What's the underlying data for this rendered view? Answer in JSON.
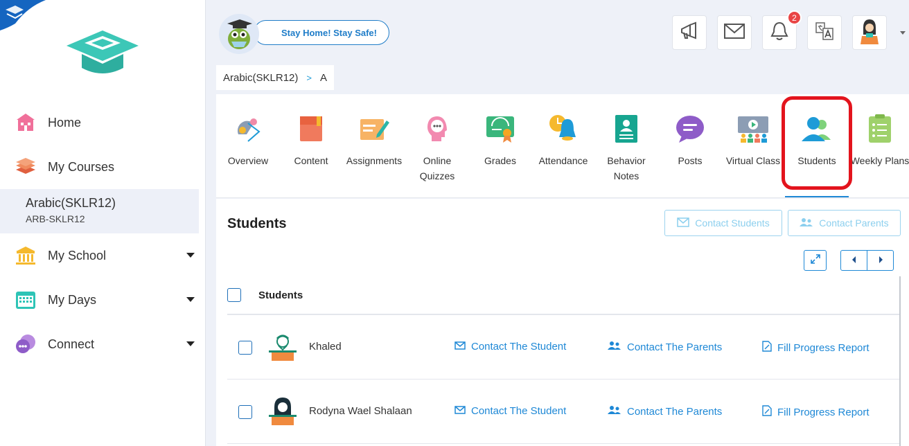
{
  "sidebar": {
    "items": [
      {
        "label": "Home",
        "icon": "home-icon"
      },
      {
        "label": "My Courses",
        "icon": "books-icon"
      },
      {
        "label": "My School",
        "icon": "school-icon"
      },
      {
        "label": "My Days",
        "icon": "calendar-icon"
      },
      {
        "label": "Connect",
        "icon": "chat-icon"
      }
    ],
    "course": {
      "title": "Arabic(SKLR12)",
      "code": "ARB-SKLR12"
    }
  },
  "header": {
    "banner": "Stay Home! Stay Safe!",
    "notifications_count": "2",
    "breadcrumb": {
      "course": "Arabic(SKLR12)",
      "separator": ">",
      "section": "A"
    }
  },
  "tabs": [
    {
      "label": "Overview"
    },
    {
      "label": "Content"
    },
    {
      "label": "Assignments"
    },
    {
      "label": "Online Quizzes"
    },
    {
      "label": "Grades"
    },
    {
      "label": "Attendance"
    },
    {
      "label": "Behavior Notes"
    },
    {
      "label": "Posts"
    },
    {
      "label": "Virtual Class"
    },
    {
      "label": "Students"
    },
    {
      "label": "Weekly Plans"
    }
  ],
  "active_tab": "Students",
  "main": {
    "title": "Students",
    "contact_students": "Contact Students",
    "contact_parents": "Contact Parents",
    "table_header": "Students",
    "rows": [
      {
        "name": "Khaled",
        "contact_student": "Contact The Student",
        "contact_parents": "Contact The Parents",
        "progress": "Fill Progress Report"
      },
      {
        "name": "Rodyna Wael Shalaan",
        "contact_student": "Contact The Student",
        "contact_parents": "Contact The Parents",
        "progress": "Fill Progress Report"
      }
    ]
  },
  "colors": {
    "accent": "#1e88d6",
    "highlight": "#e3141d",
    "badge": "#e94545"
  }
}
